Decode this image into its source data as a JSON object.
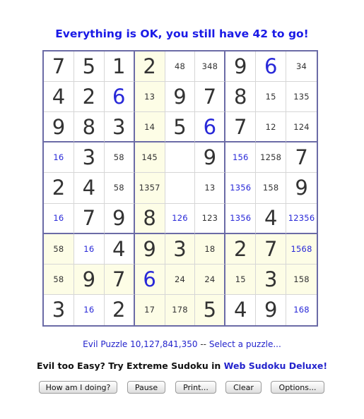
{
  "status": "Everything is OK, you still have 42 to go!",
  "board": {
    "rows": [
      [
        {
          "v": "7",
          "t": "g"
        },
        {
          "v": "5",
          "t": "g"
        },
        {
          "v": "1",
          "t": "g"
        },
        {
          "v": "2",
          "t": "g"
        },
        {
          "v": "48",
          "t": "c"
        },
        {
          "v": "348",
          "t": "c"
        },
        {
          "v": "9",
          "t": "g"
        },
        {
          "v": "6",
          "t": "e"
        },
        {
          "v": "34",
          "t": "c"
        }
      ],
      [
        {
          "v": "4",
          "t": "g"
        },
        {
          "v": "2",
          "t": "g"
        },
        {
          "v": "6",
          "t": "e"
        },
        {
          "v": "13",
          "t": "c"
        },
        {
          "v": "9",
          "t": "g"
        },
        {
          "v": "7",
          "t": "g"
        },
        {
          "v": "8",
          "t": "g"
        },
        {
          "v": "15",
          "t": "c"
        },
        {
          "v": "135",
          "t": "c"
        }
      ],
      [
        {
          "v": "9",
          "t": "g"
        },
        {
          "v": "8",
          "t": "g"
        },
        {
          "v": "3",
          "t": "g"
        },
        {
          "v": "14",
          "t": "c"
        },
        {
          "v": "5",
          "t": "g"
        },
        {
          "v": "6",
          "t": "e"
        },
        {
          "v": "7",
          "t": "g"
        },
        {
          "v": "12",
          "t": "c"
        },
        {
          "v": "124",
          "t": "c"
        }
      ],
      [
        {
          "v": "16",
          "t": "cb"
        },
        {
          "v": "3",
          "t": "g"
        },
        {
          "v": "58",
          "t": "c"
        },
        {
          "v": "145",
          "t": "c"
        },
        {
          "v": "",
          "t": "c"
        },
        {
          "v": "9",
          "t": "g"
        },
        {
          "v": "156",
          "t": "cb"
        },
        {
          "v": "1258",
          "t": "c"
        },
        {
          "v": "7",
          "t": "g"
        }
      ],
      [
        {
          "v": "2",
          "t": "g"
        },
        {
          "v": "4",
          "t": "g"
        },
        {
          "v": "58",
          "t": "c"
        },
        {
          "v": "1357",
          "t": "c"
        },
        {
          "v": "",
          "t": "c"
        },
        {
          "v": "13",
          "t": "c"
        },
        {
          "v": "1356",
          "t": "cb"
        },
        {
          "v": "158",
          "t": "c"
        },
        {
          "v": "9",
          "t": "g"
        }
      ],
      [
        {
          "v": "16",
          "t": "cb"
        },
        {
          "v": "7",
          "t": "g"
        },
        {
          "v": "9",
          "t": "g"
        },
        {
          "v": "8",
          "t": "g"
        },
        {
          "v": "126",
          "t": "cb"
        },
        {
          "v": "123",
          "t": "c"
        },
        {
          "v": "1356",
          "t": "cb"
        },
        {
          "v": "4",
          "t": "g"
        },
        {
          "v": "12356",
          "t": "cb"
        }
      ],
      [
        {
          "v": "58",
          "t": "c"
        },
        {
          "v": "16",
          "t": "cb"
        },
        {
          "v": "4",
          "t": "g"
        },
        {
          "v": "9",
          "t": "g"
        },
        {
          "v": "3",
          "t": "g"
        },
        {
          "v": "18",
          "t": "c"
        },
        {
          "v": "2",
          "t": "g"
        },
        {
          "v": "7",
          "t": "g"
        },
        {
          "v": "1568",
          "t": "cb"
        }
      ],
      [
        {
          "v": "58",
          "t": "c"
        },
        {
          "v": "9",
          "t": "g"
        },
        {
          "v": "7",
          "t": "g"
        },
        {
          "v": "6",
          "t": "e"
        },
        {
          "v": "24",
          "t": "c"
        },
        {
          "v": "24",
          "t": "c"
        },
        {
          "v": "15",
          "t": "c"
        },
        {
          "v": "3",
          "t": "g"
        },
        {
          "v": "158",
          "t": "c"
        }
      ],
      [
        {
          "v": "3",
          "t": "g"
        },
        {
          "v": "16",
          "t": "cb"
        },
        {
          "v": "2",
          "t": "g"
        },
        {
          "v": "17",
          "t": "c"
        },
        {
          "v": "178",
          "t": "c"
        },
        {
          "v": "5",
          "t": "g"
        },
        {
          "v": "4",
          "t": "g"
        },
        {
          "v": "9",
          "t": "g"
        },
        {
          "v": "168",
          "t": "cb"
        }
      ]
    ],
    "highlighted": [
      [
        0,
        3
      ],
      [
        1,
        3
      ],
      [
        2,
        3
      ],
      [
        3,
        3
      ],
      [
        4,
        3
      ],
      [
        5,
        3
      ],
      [
        6,
        0
      ],
      [
        6,
        3
      ],
      [
        6,
        4
      ],
      [
        6,
        5
      ],
      [
        6,
        6
      ],
      [
        6,
        7
      ],
      [
        6,
        8
      ],
      [
        7,
        0
      ],
      [
        7,
        1
      ],
      [
        7,
        2
      ],
      [
        7,
        3
      ],
      [
        7,
        4
      ],
      [
        7,
        5
      ],
      [
        7,
        6
      ],
      [
        7,
        7
      ],
      [
        7,
        8
      ],
      [
        8,
        3
      ],
      [
        8,
        4
      ],
      [
        8,
        5
      ]
    ]
  },
  "puzzle_line": {
    "puzzle_link": "Evil Puzzle 10,127,841,350",
    "separator": " -- ",
    "select_link": "Select a puzzle..."
  },
  "promo": {
    "text": "Evil too Easy? Try Extreme Sudoku in ",
    "link": "Web Sudoku Deluxe!"
  },
  "buttons": {
    "how_am_i_doing": "How am I doing?",
    "pause": "Pause",
    "print": "Print...",
    "clear": "Clear",
    "options": "Options..."
  }
}
